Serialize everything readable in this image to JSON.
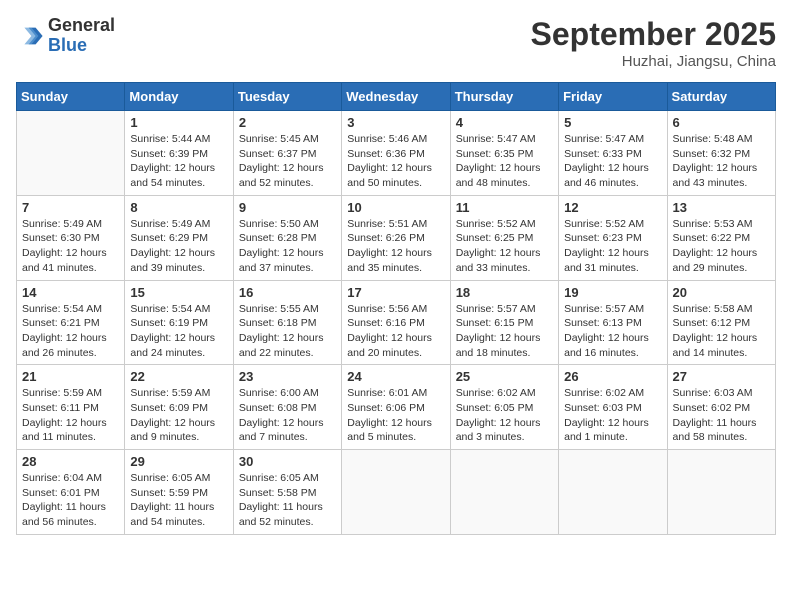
{
  "logo": {
    "general": "General",
    "blue": "Blue"
  },
  "header": {
    "month": "September 2025",
    "location": "Huzhai, Jiangsu, China"
  },
  "days_of_week": [
    "Sunday",
    "Monday",
    "Tuesday",
    "Wednesday",
    "Thursday",
    "Friday",
    "Saturday"
  ],
  "weeks": [
    [
      {
        "day": "",
        "info": ""
      },
      {
        "day": "1",
        "info": "Sunrise: 5:44 AM\nSunset: 6:39 PM\nDaylight: 12 hours\nand 54 minutes."
      },
      {
        "day": "2",
        "info": "Sunrise: 5:45 AM\nSunset: 6:37 PM\nDaylight: 12 hours\nand 52 minutes."
      },
      {
        "day": "3",
        "info": "Sunrise: 5:46 AM\nSunset: 6:36 PM\nDaylight: 12 hours\nand 50 minutes."
      },
      {
        "day": "4",
        "info": "Sunrise: 5:47 AM\nSunset: 6:35 PM\nDaylight: 12 hours\nand 48 minutes."
      },
      {
        "day": "5",
        "info": "Sunrise: 5:47 AM\nSunset: 6:33 PM\nDaylight: 12 hours\nand 46 minutes."
      },
      {
        "day": "6",
        "info": "Sunrise: 5:48 AM\nSunset: 6:32 PM\nDaylight: 12 hours\nand 43 minutes."
      }
    ],
    [
      {
        "day": "7",
        "info": "Sunrise: 5:49 AM\nSunset: 6:30 PM\nDaylight: 12 hours\nand 41 minutes."
      },
      {
        "day": "8",
        "info": "Sunrise: 5:49 AM\nSunset: 6:29 PM\nDaylight: 12 hours\nand 39 minutes."
      },
      {
        "day": "9",
        "info": "Sunrise: 5:50 AM\nSunset: 6:28 PM\nDaylight: 12 hours\nand 37 minutes."
      },
      {
        "day": "10",
        "info": "Sunrise: 5:51 AM\nSunset: 6:26 PM\nDaylight: 12 hours\nand 35 minutes."
      },
      {
        "day": "11",
        "info": "Sunrise: 5:52 AM\nSunset: 6:25 PM\nDaylight: 12 hours\nand 33 minutes."
      },
      {
        "day": "12",
        "info": "Sunrise: 5:52 AM\nSunset: 6:23 PM\nDaylight: 12 hours\nand 31 minutes."
      },
      {
        "day": "13",
        "info": "Sunrise: 5:53 AM\nSunset: 6:22 PM\nDaylight: 12 hours\nand 29 minutes."
      }
    ],
    [
      {
        "day": "14",
        "info": "Sunrise: 5:54 AM\nSunset: 6:21 PM\nDaylight: 12 hours\nand 26 minutes."
      },
      {
        "day": "15",
        "info": "Sunrise: 5:54 AM\nSunset: 6:19 PM\nDaylight: 12 hours\nand 24 minutes."
      },
      {
        "day": "16",
        "info": "Sunrise: 5:55 AM\nSunset: 6:18 PM\nDaylight: 12 hours\nand 22 minutes."
      },
      {
        "day": "17",
        "info": "Sunrise: 5:56 AM\nSunset: 6:16 PM\nDaylight: 12 hours\nand 20 minutes."
      },
      {
        "day": "18",
        "info": "Sunrise: 5:57 AM\nSunset: 6:15 PM\nDaylight: 12 hours\nand 18 minutes."
      },
      {
        "day": "19",
        "info": "Sunrise: 5:57 AM\nSunset: 6:13 PM\nDaylight: 12 hours\nand 16 minutes."
      },
      {
        "day": "20",
        "info": "Sunrise: 5:58 AM\nSunset: 6:12 PM\nDaylight: 12 hours\nand 14 minutes."
      }
    ],
    [
      {
        "day": "21",
        "info": "Sunrise: 5:59 AM\nSunset: 6:11 PM\nDaylight: 12 hours\nand 11 minutes."
      },
      {
        "day": "22",
        "info": "Sunrise: 5:59 AM\nSunset: 6:09 PM\nDaylight: 12 hours\nand 9 minutes."
      },
      {
        "day": "23",
        "info": "Sunrise: 6:00 AM\nSunset: 6:08 PM\nDaylight: 12 hours\nand 7 minutes."
      },
      {
        "day": "24",
        "info": "Sunrise: 6:01 AM\nSunset: 6:06 PM\nDaylight: 12 hours\nand 5 minutes."
      },
      {
        "day": "25",
        "info": "Sunrise: 6:02 AM\nSunset: 6:05 PM\nDaylight: 12 hours\nand 3 minutes."
      },
      {
        "day": "26",
        "info": "Sunrise: 6:02 AM\nSunset: 6:03 PM\nDaylight: 12 hours\nand 1 minute."
      },
      {
        "day": "27",
        "info": "Sunrise: 6:03 AM\nSunset: 6:02 PM\nDaylight: 11 hours\nand 58 minutes."
      }
    ],
    [
      {
        "day": "28",
        "info": "Sunrise: 6:04 AM\nSunset: 6:01 PM\nDaylight: 11 hours\nand 56 minutes."
      },
      {
        "day": "29",
        "info": "Sunrise: 6:05 AM\nSunset: 5:59 PM\nDaylight: 11 hours\nand 54 minutes."
      },
      {
        "day": "30",
        "info": "Sunrise: 6:05 AM\nSunset: 5:58 PM\nDaylight: 11 hours\nand 52 minutes."
      },
      {
        "day": "",
        "info": ""
      },
      {
        "day": "",
        "info": ""
      },
      {
        "day": "",
        "info": ""
      },
      {
        "day": "",
        "info": ""
      }
    ]
  ]
}
